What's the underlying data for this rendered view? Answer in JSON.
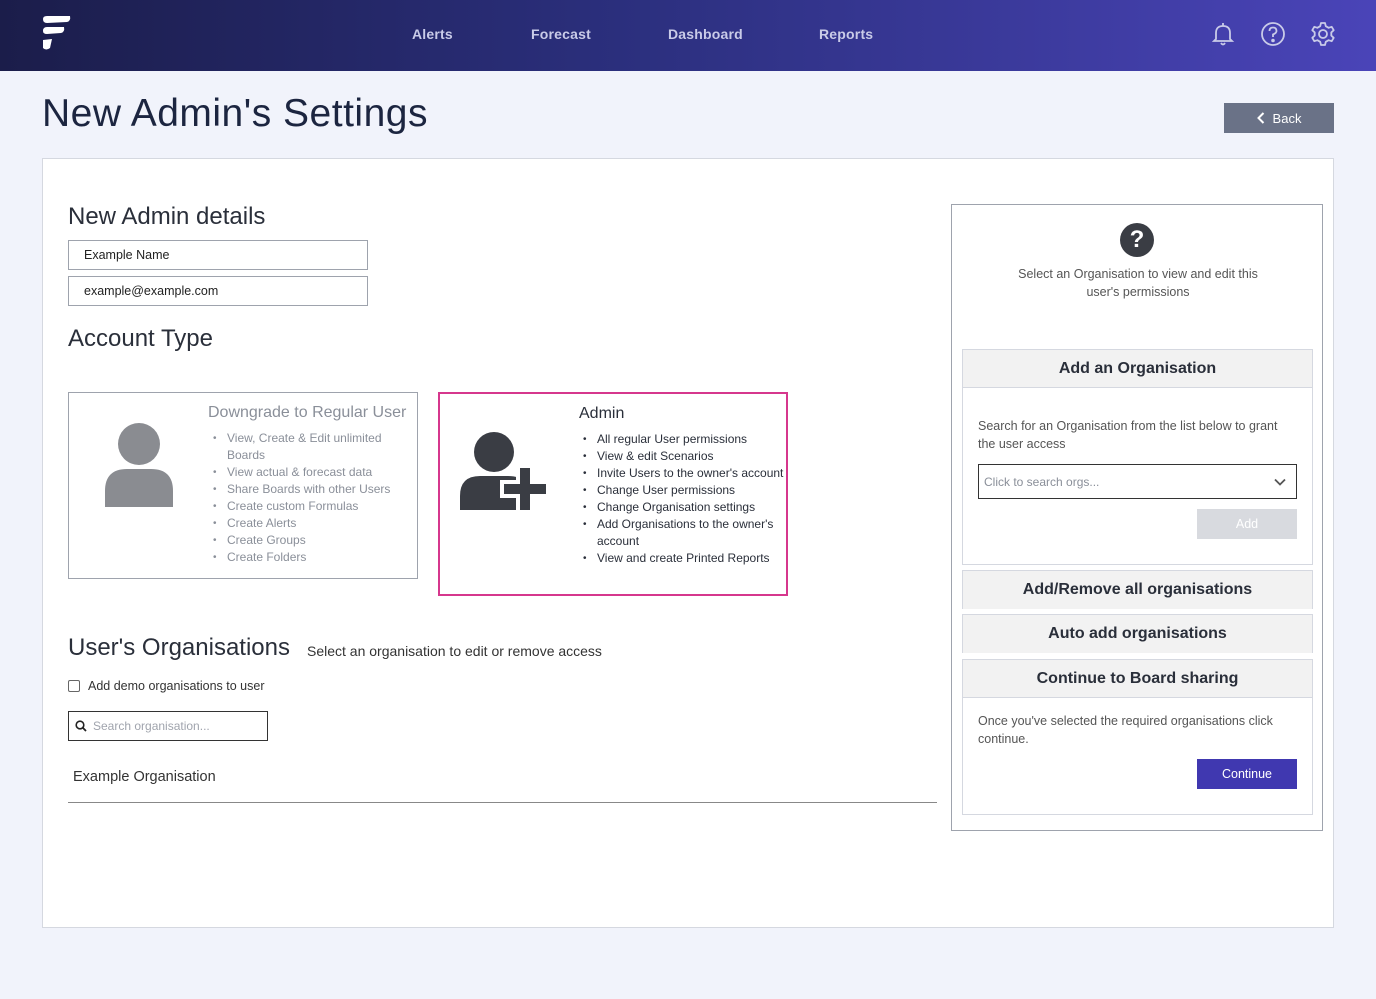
{
  "nav": {
    "links": [
      "Alerts",
      "Forecast",
      "Dashboard",
      "Reports"
    ]
  },
  "page": {
    "title": "New Admin's Settings",
    "back_label": "Back"
  },
  "details": {
    "heading": "New Admin details",
    "name_value": "Example Name",
    "email_value": "example@example.com"
  },
  "account_type": {
    "heading": "Account Type",
    "regular": {
      "title": "Downgrade to Regular User",
      "items": [
        "View, Create & Edit unlimited Boards",
        "View actual & forecast data",
        "Share Boards with other Users",
        "Create custom Formulas",
        "Create Alerts",
        "Create Groups",
        "Create Folders"
      ]
    },
    "admin": {
      "title": "Admin",
      "selected": true,
      "items": [
        "All regular User permissions",
        "View & edit Scenarios",
        "Invite Users to the owner's account",
        "Change User permissions",
        "Change Organisation settings",
        "Add Organisations to the owner's account",
        "View and create Printed Reports"
      ]
    }
  },
  "orgs": {
    "heading": "User's Organisations",
    "subheading": "Select an organisation to edit or remove access",
    "demo_checkbox_label": "Add demo organisations to user",
    "search_placeholder": "Search organisation...",
    "list": [
      "Example Organisation"
    ]
  },
  "side": {
    "info": "Select an Organisation to view and edit this user's permissions",
    "add_org": {
      "title": "Add an Organisation",
      "text": "Search for an Organisation from the list below to grant the user access",
      "select_placeholder": "Click to search orgs...",
      "add_label": "Add"
    },
    "add_remove_all": "Add/Remove all organisations",
    "auto_add": "Auto add organisations",
    "continue_section": {
      "title": "Continue to Board sharing",
      "text": "Once you've selected the required organisations click continue.",
      "button": "Continue"
    }
  },
  "colors": {
    "accent": "#4038b0",
    "selected_border": "#d6378d",
    "nav_start": "#1b1d4a",
    "nav_end": "#4a44b8"
  }
}
